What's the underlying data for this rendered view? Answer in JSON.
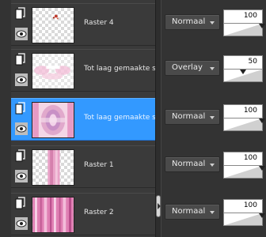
{
  "layers": [
    {
      "name": "Raster 4",
      "blend_mode": "Normaal",
      "opacity": "100",
      "opacity_fraction": 1.0,
      "selected": false,
      "thumb": "sparse-red-dots"
    },
    {
      "name": "Tot laag gemaakte selectie",
      "blend_mode": "Overlay",
      "opacity": "50",
      "opacity_fraction": 0.5,
      "selected": false,
      "thumb": "pink-soft-blur"
    },
    {
      "name": "Tot laag gemaakte selectie",
      "blend_mode": "Normaal",
      "opacity": "100",
      "opacity_fraction": 1.0,
      "selected": true,
      "thumb": "pink-radial-pattern"
    },
    {
      "name": "Raster 1",
      "blend_mode": "Normaal",
      "opacity": "100",
      "opacity_fraction": 1.0,
      "selected": false,
      "thumb": "pink-vertical-band"
    },
    {
      "name": "Raster 2",
      "blend_mode": "Normaal",
      "opacity": "100",
      "opacity_fraction": 1.0,
      "selected": false,
      "thumb": "pink-stripes"
    }
  ],
  "icons": {
    "layer": "raster-layer-icon",
    "visibility": "eye-icon",
    "dropdown": "chevron-down-icon",
    "collapse": "panel-splitter-arrow-icon"
  },
  "colors": {
    "selected_row": "#3399ff",
    "row_bg": "#3a3a3a",
    "panel_bg": "#333333",
    "text": "#e6e6e6"
  }
}
